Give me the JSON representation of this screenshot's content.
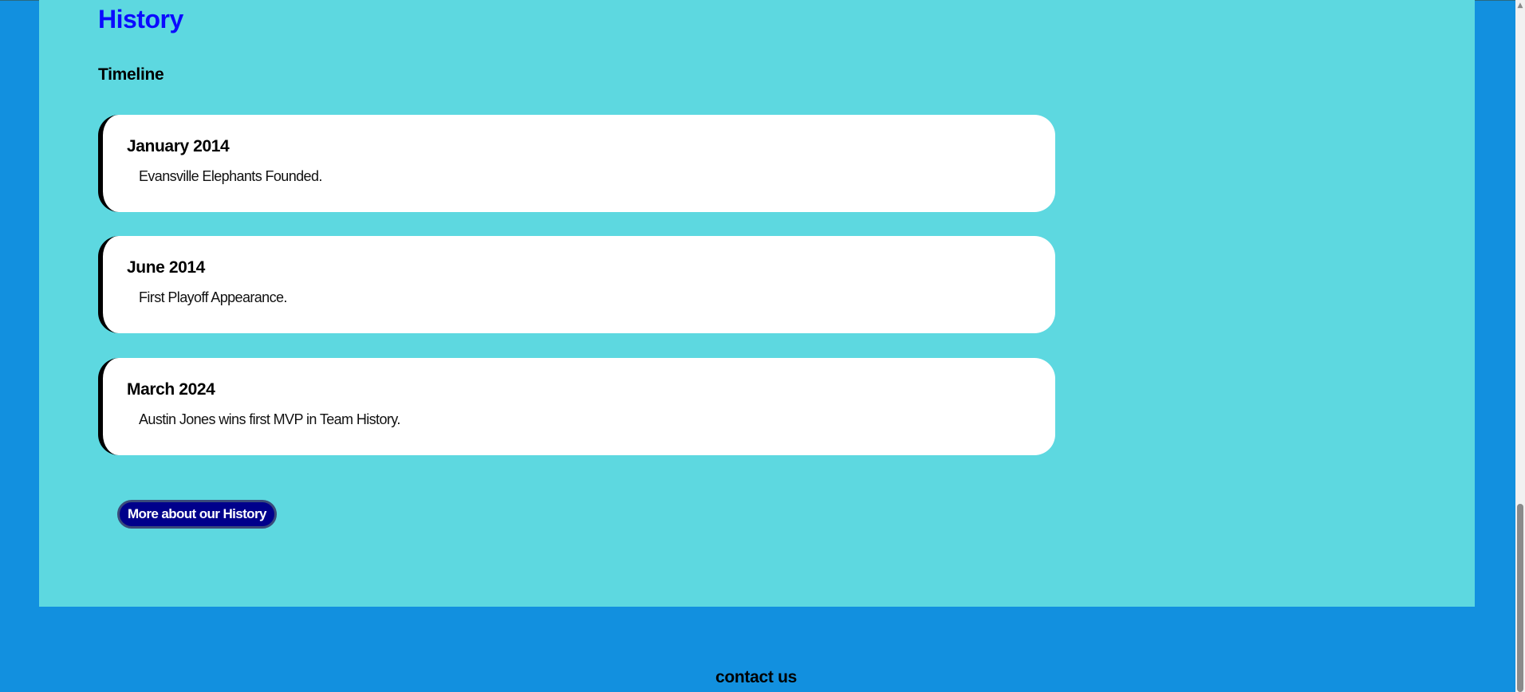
{
  "history": {
    "title": "History",
    "subtitle": "Timeline",
    "timeline": [
      {
        "date": "January 2014",
        "description": "Evansville Elephants Founded."
      },
      {
        "date": "June 2014",
        "description": "First Playoff Appearance."
      },
      {
        "date": "March 2024",
        "description": "Austin Jones wins first MVP in Team History."
      }
    ],
    "button_label": "More about our History"
  },
  "footer": {
    "heading": "contact us"
  },
  "colors": {
    "page_background": "#1290df",
    "panel_background": "#5dd8e0",
    "title_color": "#0b0bff",
    "button_background": "#00008b"
  },
  "icons": {
    "scroll_up": "scroll-up-arrow-icon"
  }
}
